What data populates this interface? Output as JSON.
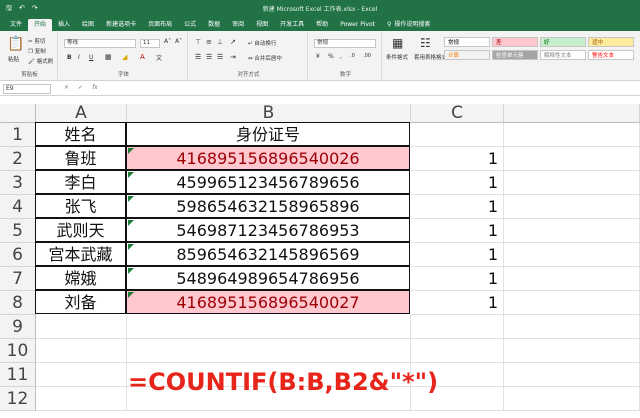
{
  "window": {
    "title": "新建 Microsoft Excel 工作表.xlsx  -  Excel",
    "qat": [
      "save-icon",
      "undo-icon",
      "redo-icon"
    ]
  },
  "tabs": [
    "文件",
    "开始",
    "插入",
    "绘图",
    "新建选项卡",
    "页面布局",
    "公式",
    "数据",
    "审阅",
    "视图",
    "开发工具",
    "帮助",
    "Power Pivot"
  ],
  "active_tab": "开始",
  "tell_me": "操作说明搜索",
  "ribbon": {
    "clipboard": {
      "label": "剪贴板",
      "paste": "粘贴",
      "cut": "剪切",
      "copy": "复制",
      "format_painter": "格式刷"
    },
    "font": {
      "label": "字体",
      "name": "等线",
      "size": "11",
      "bold": "B",
      "italic": "I",
      "underline": "U"
    },
    "alignment": {
      "label": "对齐方式",
      "wrap": "自动换行",
      "merge": "合并后居中"
    },
    "number": {
      "label": "数字",
      "format": "常规"
    },
    "styles": {
      "conditional": "条件格式",
      "table": "套用表格格式",
      "boxes": [
        {
          "label": "常规",
          "bg": "#ffffff",
          "color": "#000000"
        },
        {
          "label": "差",
          "bg": "#ffc7ce",
          "color": "#9c0006"
        },
        {
          "label": "好",
          "bg": "#c6efce",
          "color": "#006100"
        },
        {
          "label": "适中",
          "bg": "#ffeb9c",
          "color": "#9c5700"
        },
        {
          "label": "计算",
          "bg": "#f2f2f2",
          "color": "#fa7d00"
        },
        {
          "label": "检查单元格",
          "bg": "#a5a5a5",
          "color": "#ffffff"
        },
        {
          "label": "解释性文本",
          "bg": "#ffffff",
          "color": "#7f7f7f"
        },
        {
          "label": "警告文本",
          "bg": "#ffffff",
          "color": "#ff0000"
        }
      ]
    }
  },
  "formula_bar": {
    "name_box": "E9",
    "cancel": "×",
    "enter": "✓",
    "fx": "fx"
  },
  "columns": [
    "A",
    "B",
    "C"
  ],
  "rows": [
    "1",
    "2",
    "3",
    "4",
    "5",
    "6",
    "7",
    "8",
    "9",
    "10",
    "11",
    "12"
  ],
  "table": {
    "header": {
      "a": "姓名",
      "b": "身份证号"
    },
    "data": [
      {
        "name": "鲁班",
        "id": "416895156896540026",
        "c": "1",
        "dup": true
      },
      {
        "name": "李白",
        "id": "459965123456789656",
        "c": "1",
        "dup": false
      },
      {
        "name": "张飞",
        "id": "598654632158965896",
        "c": "1",
        "dup": false
      },
      {
        "name": "武则天",
        "id": "546987123456786953",
        "c": "1",
        "dup": false
      },
      {
        "name": "宫本武藏",
        "id": "859654632145896569",
        "c": "1",
        "dup": false
      },
      {
        "name": "嫦娥",
        "id": "548964989654786956",
        "c": "1",
        "dup": false
      },
      {
        "name": "刘备",
        "id": "416895156896540027",
        "c": "1",
        "dup": true
      }
    ]
  },
  "annotation": "=COUNTIF(B:B,B2&\"*\")",
  "colors": {
    "excel_green": "#217346",
    "duplicate_fill": "#ffc7ce",
    "duplicate_text": "#9c0006",
    "annotation": "#e8251b"
  }
}
